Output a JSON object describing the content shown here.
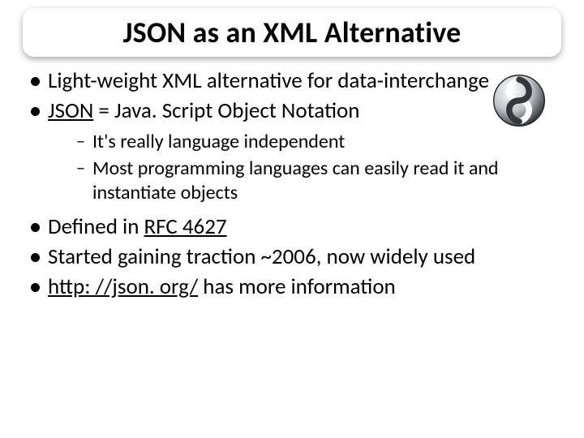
{
  "title": "JSON as an XML Alternative",
  "bullets": {
    "b1": {
      "pre": " Light-weight XML alternative for data-interchange"
    },
    "b2": {
      "u": "JSON",
      "post": " = Java. Script Object Notation"
    },
    "b2subs": {
      "s1": " It's really language independent",
      "s2": " Most programming languages can easily read it and instantiate objects"
    },
    "b3": {
      "pre": "Defined in ",
      "u": "RFC 4627"
    },
    "b4": {
      "pre": "Started gaining traction ~2006, now widely used"
    },
    "b5": {
      "u": "http: //json. org/",
      "post": " has more information"
    }
  },
  "logo": {
    "name": "json-logo"
  }
}
